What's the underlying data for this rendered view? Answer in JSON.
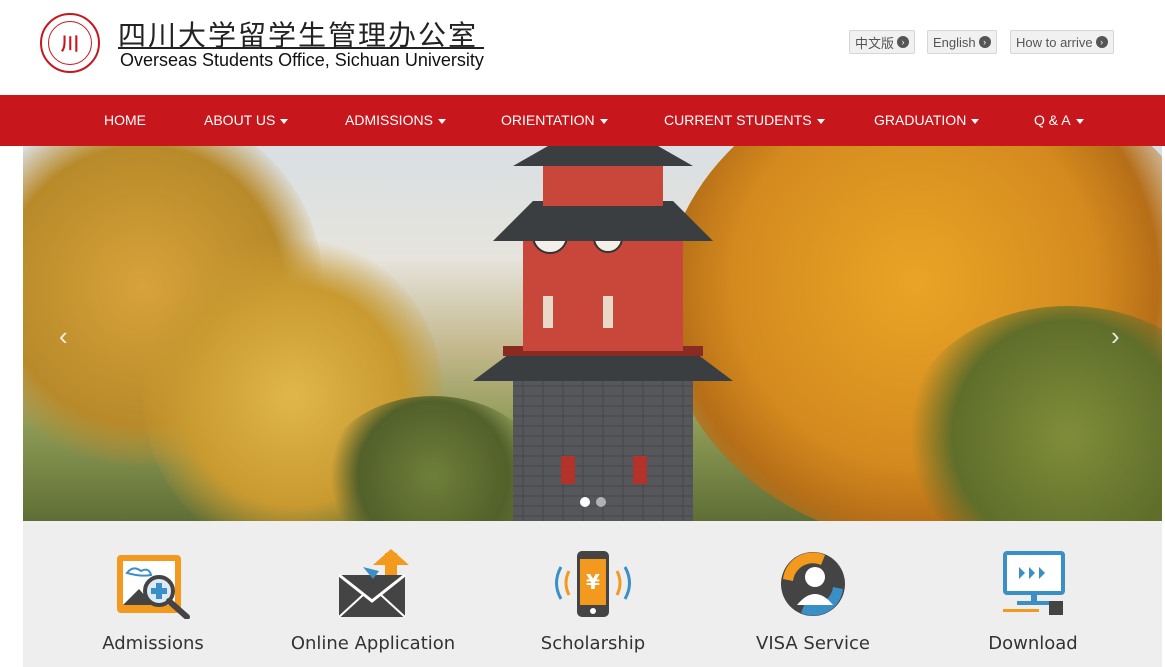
{
  "header": {
    "logo_cn": "四川大学留学生管理办公室",
    "logo_en": "Overseas Students Office, Sichuan University",
    "seal_text": "川",
    "lang_links": [
      {
        "label": "中文版"
      },
      {
        "label": "English"
      },
      {
        "label": "How to arrive"
      }
    ]
  },
  "nav": {
    "items": [
      {
        "label": "HOME",
        "has_dropdown": false
      },
      {
        "label": "ABOUT US",
        "has_dropdown": true
      },
      {
        "label": "ADMISSIONS",
        "has_dropdown": true
      },
      {
        "label": "ORIENTATION",
        "has_dropdown": true
      },
      {
        "label": "CURRENT STUDENTS",
        "has_dropdown": true
      },
      {
        "label": "GRADUATION",
        "has_dropdown": true
      },
      {
        "label": "Q & A",
        "has_dropdown": true
      }
    ]
  },
  "carousel": {
    "prev_icon": "chevron-left-icon",
    "next_icon": "chevron-right-icon",
    "slide_count": 2,
    "active_slide": 1
  },
  "services": [
    {
      "label": "Admissions",
      "icon": "admissions-icon"
    },
    {
      "label": "Online Application",
      "icon": "mail-upload-icon"
    },
    {
      "label": "Scholarship",
      "icon": "phone-yen-icon"
    },
    {
      "label": "VISA Service",
      "icon": "person-refresh-icon"
    },
    {
      "label": "Download",
      "icon": "monitor-download-icon"
    }
  ],
  "colors": {
    "brand_red": "#c8161d",
    "accent_orange": "#f39a1e",
    "icon_blue": "#3a8fc7"
  }
}
